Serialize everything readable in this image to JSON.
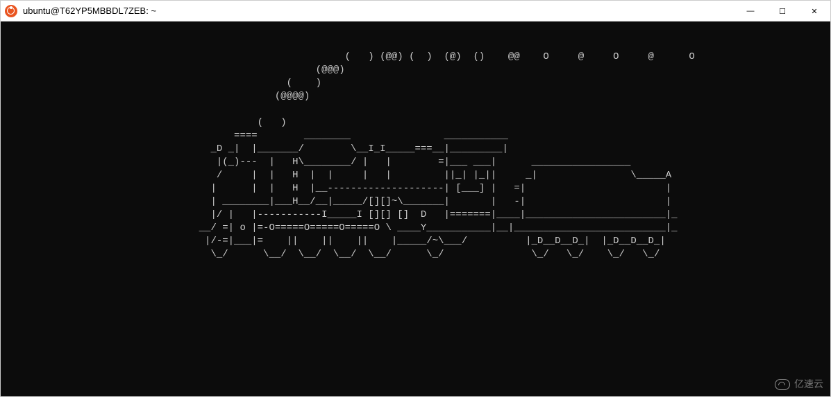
{
  "window": {
    "title": "ubuntu@T62YP5MBBDL7ZEB: ~",
    "icon_name": "ubuntu-logo"
  },
  "titlebar_controls": {
    "minimize_glyph": "—",
    "maximize_glyph": "☐",
    "close_glyph": "✕"
  },
  "terminal": {
    "ascii_art": "                                                           (   ) (@@) (  )  (@)  ()    @@    O     @     O     @      O\n                                                      (@@@)\n                                                 (    )\n                                               (@@@@)\n\n                                            (   )\n                                        ====        ________                ___________\n                                    _D _|  |_______/        \\__I_I_____===__|_________|\n                                     |(_)---  |   H\\________/ |   |        =|___ ___|      _________________\n                                     /     |  |   H  |  |     |   |         ||_| |_||     _|                \\_____A\n                                    |      |  |   H  |__--------------------| [___] |   =|                        |\n                                    | ________|___H__/__|_____/[][]~\\_______|       |   -|                        |\n                                    |/ |   |-----------I_____I [][] []  D   |=======|____|________________________|_\n                                  __/ =| o |=-O=====O=====O=====O \\ ____Y___________|__|__________________________|_\n                                   |/-=|___|=    ||    ||    ||    |_____/~\\___/          |_D__D__D_|  |_D__D__D_|\n                                    \\_/      \\__/  \\__/  \\__/  \\__/      \\_/               \\_/   \\_/    \\_/   \\_/"
  },
  "watermark": {
    "text": "亿速云"
  }
}
